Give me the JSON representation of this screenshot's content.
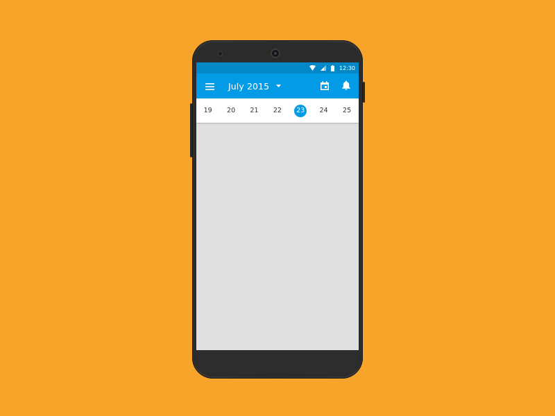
{
  "background_color": "#F6A42A",
  "accent_color": "#039BE5",
  "status_bar": {
    "time": "12:30",
    "icons": [
      "wifi-icon",
      "signal-icon",
      "battery-icon"
    ]
  },
  "app_bar": {
    "menu_icon": "menu-icon",
    "month_title": "July 2015",
    "dropdown_icon": "dropdown-arrow-icon",
    "today_icon": "calendar-today-icon",
    "notification_icon": "bell-icon"
  },
  "week": {
    "days": [
      "19",
      "20",
      "21",
      "22",
      "23",
      "24",
      "25"
    ],
    "selected": "23"
  }
}
